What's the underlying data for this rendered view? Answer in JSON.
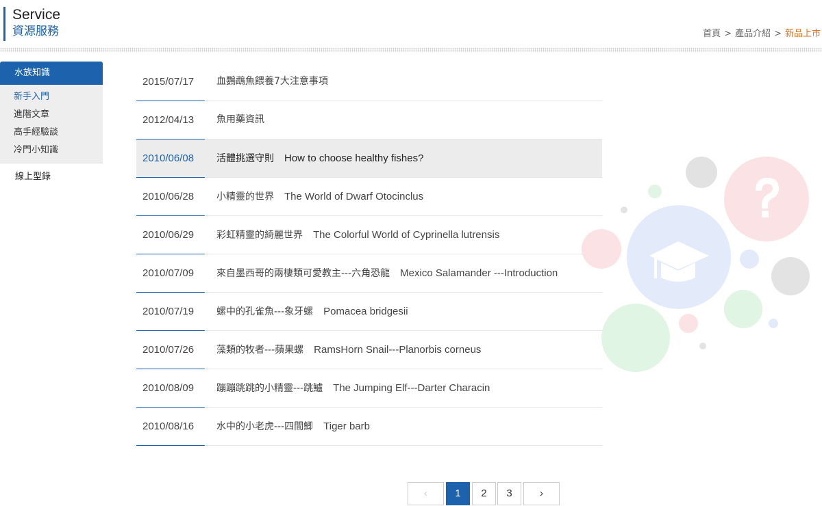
{
  "header": {
    "title_en": "Service",
    "title_zh": "資源服務",
    "breadcrumb": [
      "首頁",
      "產品介紹",
      "新品上市"
    ],
    "breadcrumb_sep": ">"
  },
  "sidebar": {
    "section_title": "水族知識",
    "sub_items": [
      "新手入門",
      "進階文章",
      "高手經驗談",
      "冷門小知識"
    ],
    "other_item": "線上型錄"
  },
  "articles": [
    {
      "date": "2015/07/17",
      "title": "血鸚鵡魚餵養7大注意事項",
      "title_en": ""
    },
    {
      "date": "2012/04/13",
      "title": "魚用藥資訊",
      "title_en": ""
    },
    {
      "date": "2010/06/08",
      "title": "活體挑選守則",
      "title_en": "How to choose healthy fishes?"
    },
    {
      "date": "2010/06/28",
      "title": "小精靈的世界",
      "title_en": "The World of Dwarf Otocinclus"
    },
    {
      "date": "2010/06/29",
      "title": "彩虹精靈的綺麗世界",
      "title_en": "The Colorful World of Cyprinella lutrensis"
    },
    {
      "date": "2010/07/09",
      "title": "來自墨西哥的兩棲類可愛教主---六角恐龍",
      "title_en": "Mexico Salamander ---Introduction"
    },
    {
      "date": "2010/07/19",
      "title": "螺中的孔雀魚---象牙螺",
      "title_en": "Pomacea bridgesii"
    },
    {
      "date": "2010/07/26",
      "title": "藻類的牧者---蘋果螺",
      "title_en": "RamsHorn Snail---Planorbis corneus"
    },
    {
      "date": "2010/08/09",
      "title": "蹦蹦跳跳的小精靈---跳鱸",
      "title_en": "The Jumping Elf---Darter Characin"
    },
    {
      "date": "2010/08/16",
      "title": "水中的小老虎---四間鯽",
      "title_en": "Tiger barb"
    }
  ],
  "pagination": {
    "prev": "‹",
    "pages": [
      "1",
      "2",
      "3"
    ],
    "current": "1",
    "next": "›"
  },
  "colors": {
    "accent": "#1d62ad",
    "breadcrumb_current": "#e0701e"
  },
  "icons": {
    "decoration": "graduation-cap-icon",
    "question": "question-mark-icon"
  }
}
